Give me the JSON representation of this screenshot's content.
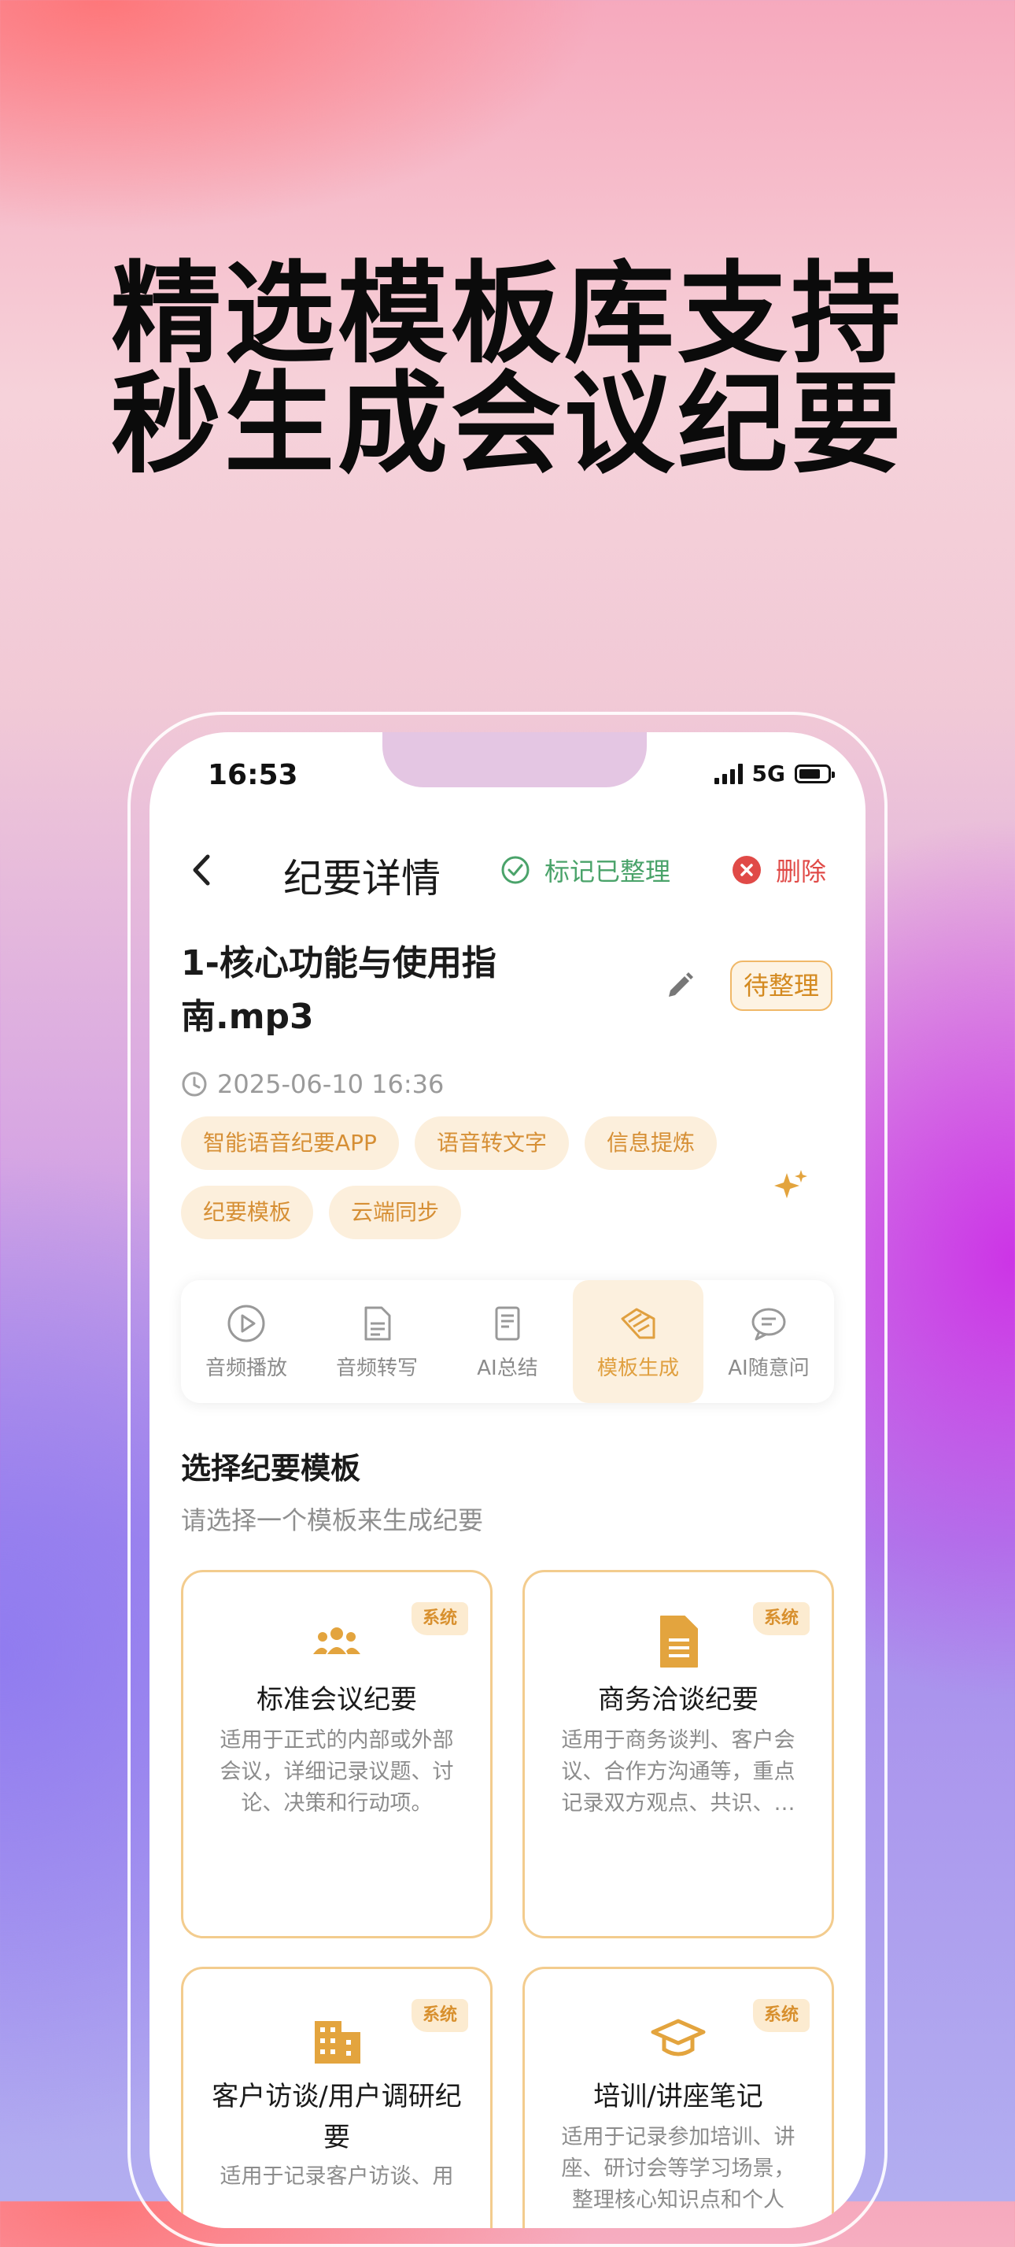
{
  "headline": {
    "line1": "精选模板库支持",
    "line2": "秒生成会议纪要"
  },
  "status_bar": {
    "time": "16:53",
    "network": "5G"
  },
  "nav": {
    "title": "纪要详情",
    "mark_label": "标记已整理",
    "delete_label": "删除"
  },
  "file": {
    "title": "1-核心功能与使用指南.mp3",
    "status": "待整理",
    "datetime": "2025-06-10 16:36",
    "tags": [
      "智能语音纪要APP",
      "语音转文字",
      "信息提炼",
      "纪要模板",
      "云端同步"
    ]
  },
  "tabs": [
    {
      "label": "音频播放",
      "icon": "play-circle-icon",
      "active": false
    },
    {
      "label": "音频转写",
      "icon": "document-icon",
      "active": false
    },
    {
      "label": "AI总结",
      "icon": "summary-icon",
      "active": false
    },
    {
      "label": "模板生成",
      "icon": "templates-icon",
      "active": true
    },
    {
      "label": "AI随意问",
      "icon": "chat-icon",
      "active": false
    }
  ],
  "templates_section": {
    "title": "选择纪要模板",
    "subtitle": "请选择一个模板来生成纪要"
  },
  "templates": [
    {
      "badge": "系统",
      "icon": "people-icon",
      "title": "标准会议纪要",
      "desc": "适用于正式的内部或外部会议，详细记录议题、讨论、决策和行动项。"
    },
    {
      "badge": "系统",
      "icon": "file-icon",
      "title": "商务洽谈纪要",
      "desc": "适用于商务谈判、客户会议、合作方沟通等，重点记录双方观点、共识、…"
    },
    {
      "badge": "系统",
      "icon": "building-icon",
      "title": "客户访谈/用户调研纪要",
      "desc": "适用于记录客户访谈、用"
    },
    {
      "badge": "系统",
      "icon": "graduation-cap-icon",
      "title": "培训/讲座笔记",
      "desc": "适用于记录参加培训、讲座、研讨会等学习场景，整理核心知识点和个人"
    }
  ],
  "colors": {
    "accent": "#E0A040",
    "green": "#4AA36A",
    "red": "#E04A47"
  }
}
